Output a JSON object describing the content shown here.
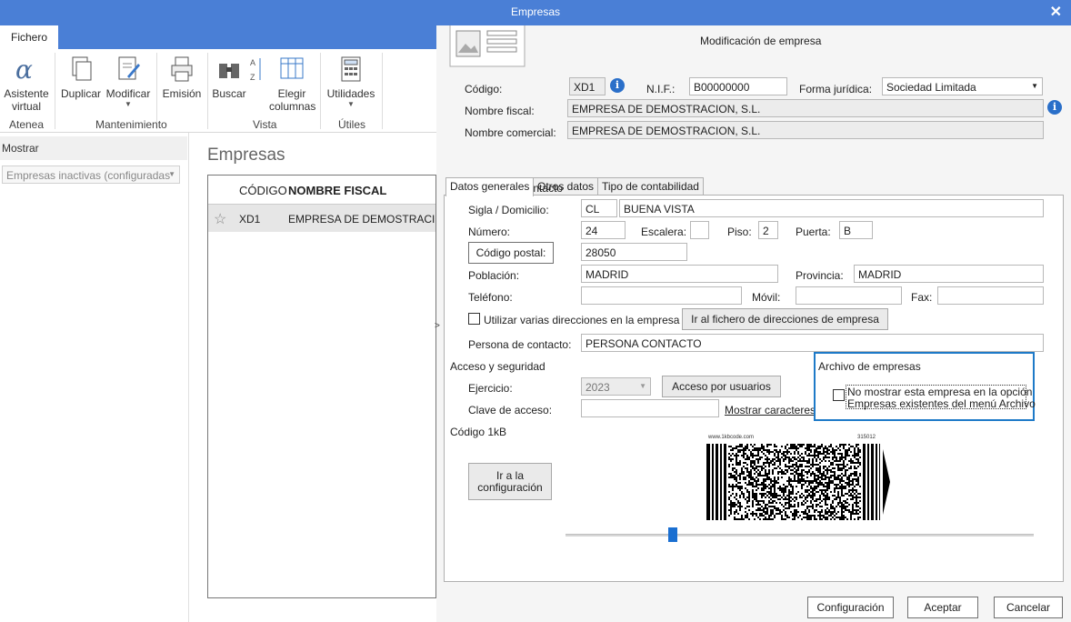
{
  "window": {
    "title": "Empresas"
  },
  "ribbon": {
    "tab": "Fichero",
    "buttons": {
      "asistente_line1": "Asistente",
      "asistente_line2": "virtual",
      "duplicar": "Duplicar",
      "modificar": "Modificar",
      "emision": "Emisión",
      "buscar": "Buscar",
      "elegir_line1": "Elegir",
      "elegir_line2": "columnas",
      "utilidades": "Utilidades"
    },
    "groups": {
      "atenea": "Atenea",
      "mantenimiento": "Mantenimiento",
      "vista": "Vista",
      "utiles": "Útiles"
    }
  },
  "left_panel": {
    "header": "Mostrar",
    "filter_value": "Empresas inactivas (configuradas"
  },
  "list": {
    "heading": "Empresas",
    "columns": [
      "CÓDIGO",
      "NOMBRE FISCAL"
    ],
    "rows": [
      {
        "codigo": "XD1",
        "nombre": "EMPRESA DE DEMOSTRACION"
      }
    ]
  },
  "dialog": {
    "title": "Modificación de empresa",
    "codigo_label": "Código:",
    "codigo_value": "XD1",
    "nif_label": "N.I.F.:",
    "nif_value": "B00000000",
    "forma_label": "Forma jurídica:",
    "forma_value": "Sociedad Limitada",
    "nombre_fiscal_label": "Nombre fiscal:",
    "nombre_fiscal_value": "EMPRESA DE DEMOSTRACION, S.L.",
    "nombre_comercial_label": "Nombre comercial:",
    "nombre_comercial_value": "EMPRESA DE DEMOSTRACION, S.L.",
    "tabs": [
      "Datos generales",
      "Otros datos",
      "Tipo de contabilidad"
    ],
    "localizacion": {
      "section": "Localización / Contacto",
      "sigla_label": "Sigla / Domicilio:",
      "sigla_value": "CL",
      "domicilio_value": "BUENA VISTA",
      "numero_label": "Número:",
      "numero_value": "24",
      "escalera_label": "Escalera:",
      "escalera_value": "",
      "piso_label": "Piso:",
      "piso_value": "2",
      "puerta_label": "Puerta:",
      "puerta_value": "B",
      "cp_button": "Código postal:",
      "cp_value": "28050",
      "poblacion_label": "Población:",
      "poblacion_value": "MADRID",
      "provincia_label": "Provincia:",
      "provincia_value": "MADRID",
      "telefono_label": "Teléfono:",
      "telefono_value": "",
      "movil_label": "Móvil:",
      "movil_value": "",
      "fax_label": "Fax:",
      "fax_value": "",
      "varias_label": "Utilizar varias direcciones en la empresa",
      "fichero_dir_button": "Ir al fichero de direcciones de empresa",
      "contacto_label": "Persona de contacto:",
      "contacto_value": "PERSONA CONTACTO"
    },
    "acceso": {
      "section": "Acceso y seguridad",
      "ejercicio_label": "Ejercicio:",
      "ejercicio_value": "2023",
      "acceso_button": "Acceso por usuarios",
      "clave_label": "Clave de acceso:",
      "clave_value": "",
      "mostrar_link": "Mostrar caracteres"
    },
    "archivo": {
      "section": "Archivo de empresas",
      "line1": "No mostrar esta empresa en la opción",
      "line2": "Empresas existentes del menú Archivo"
    },
    "codigo1kb": {
      "section": "Código 1kB",
      "button_line1": "Ir a la",
      "button_line2": "configuración",
      "barcode_url": "www.1kbcode.com",
      "barcode_num": "315012",
      "slider_value": 0.23
    },
    "footer": {
      "configuracion": "Configuración",
      "aceptar": "Aceptar",
      "cancelar": "Cancelar"
    }
  },
  "colors": {
    "titlebar": "#4a7fd6",
    "accent": "#1e7ac8",
    "info": "#2a6fc9"
  }
}
